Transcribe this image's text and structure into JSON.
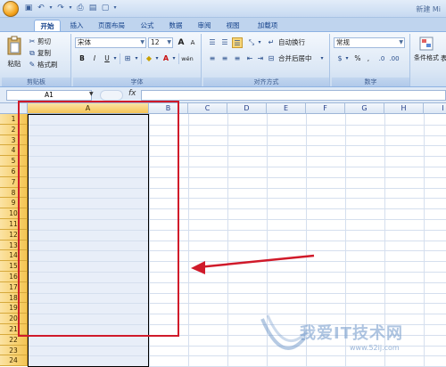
{
  "titlebar": {
    "qat_icons": [
      "save-icon",
      "undo-icon",
      "redo-icon",
      "print-icon",
      "open-icon",
      "new-icon",
      "customize-icon"
    ],
    "title": "新建 Mi"
  },
  "tabs": [
    "开始",
    "插入",
    "页面布局",
    "公式",
    "数据",
    "审阅",
    "视图",
    "加载项"
  ],
  "ribbon": {
    "clipboard": {
      "paste_label": "粘贴",
      "cut_label": "剪切",
      "copy_label": "复制",
      "format_painter_label": "格式刷",
      "group_label": "剪贴板"
    },
    "font": {
      "font_name": "宋体",
      "font_size": "12",
      "bold": "B",
      "italic": "I",
      "underline": "U",
      "grow": "A",
      "shrink": "A",
      "phonetic": "wén",
      "group_label": "字体"
    },
    "alignment": {
      "wrap_text_label": "自动换行",
      "merge_center_label": "合并后居中",
      "group_label": "对齐方式"
    },
    "number": {
      "format": "常规",
      "percent": "%",
      "comma": ",",
      "group_label": "数字"
    },
    "styles": {
      "conditional_label": "条件格式",
      "table_label": "表"
    }
  },
  "formula_bar": {
    "name_box": "A1",
    "fx_label": "fx",
    "value": ""
  },
  "grid": {
    "columns": [
      "A",
      "B",
      "C",
      "D",
      "E",
      "F",
      "G",
      "H",
      "I"
    ],
    "rows": [
      "1",
      "2",
      "3",
      "4",
      "5",
      "6",
      "7",
      "8",
      "9",
      "10",
      "11",
      "12",
      "13",
      "14",
      "15",
      "16",
      "17",
      "18",
      "19",
      "20",
      "21",
      "22",
      "23",
      "24"
    ],
    "selected_column": "A"
  },
  "colors": {
    "annotation": "#d01a2a",
    "row_header": "#f4c552",
    "column_fill": "#e8eef8"
  },
  "watermark": {
    "text": "我爱IT技术网",
    "url": "www.52ij.com"
  }
}
